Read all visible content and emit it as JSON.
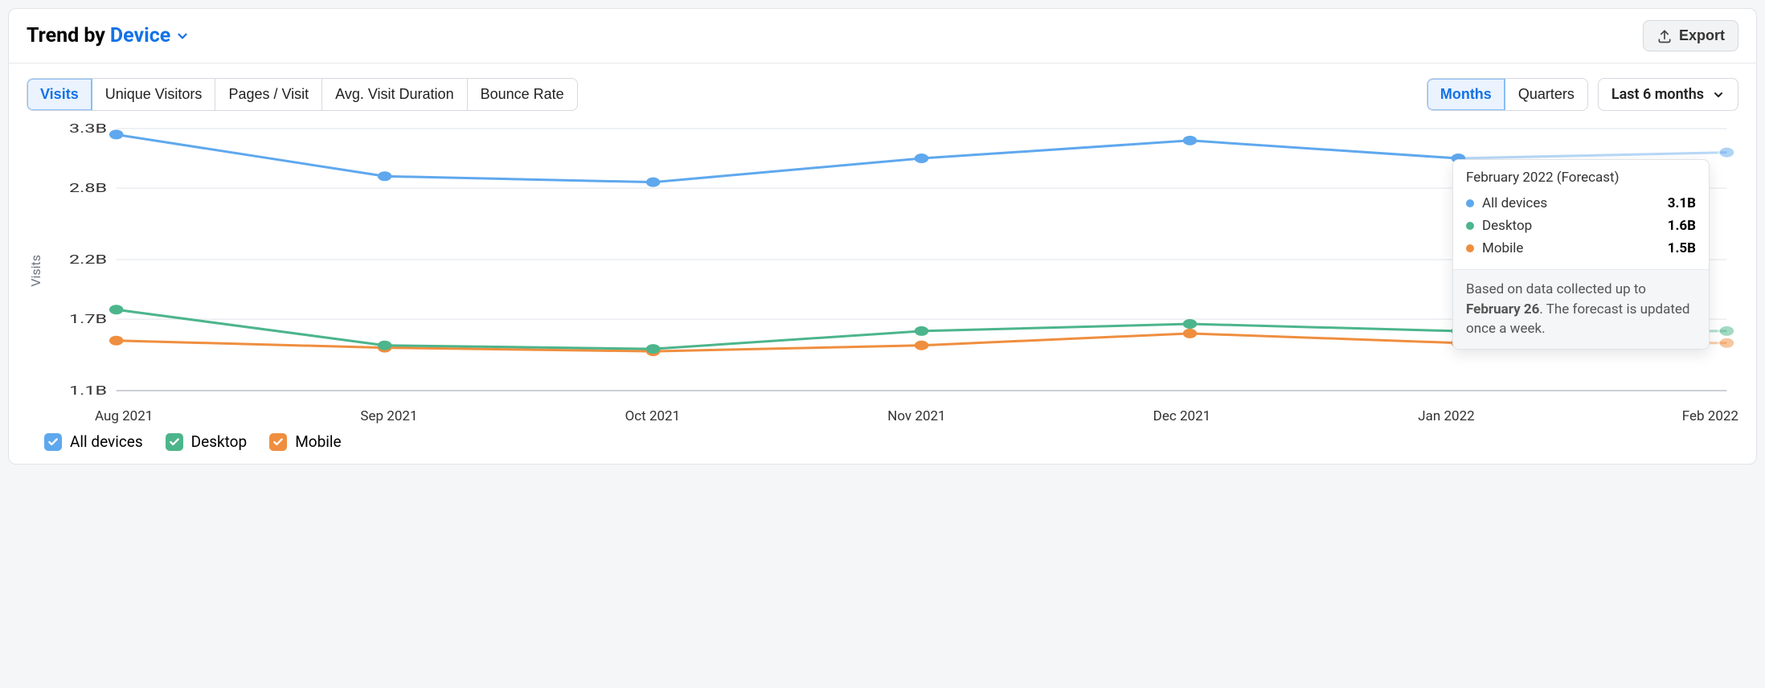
{
  "header": {
    "title_prefix": "Trend by",
    "title_link": "Device",
    "export_label": "Export"
  },
  "metrics": [
    "Visits",
    "Unique Visitors",
    "Pages / Visit",
    "Avg. Visit Duration",
    "Bounce Rate"
  ],
  "metric_selected": 0,
  "granularity": [
    "Months",
    "Quarters"
  ],
  "granularity_selected": 0,
  "range_label": "Last 6 months",
  "yaxis_title": "Visits",
  "yaxis_ticks": [
    "3.3B",
    "2.8B",
    "2.2B",
    "1.7B",
    "1.1B"
  ],
  "xaxis_ticks": [
    "Aug 2021",
    "Sep 2021",
    "Oct 2021",
    "Nov 2021",
    "Dec 2021",
    "Jan 2022",
    "Feb 2022"
  ],
  "legend": [
    {
      "label": "All devices",
      "color": "#5fa8ee"
    },
    {
      "label": "Desktop",
      "color": "#4cb58b"
    },
    {
      "label": "Mobile",
      "color": "#ef8e3f"
    }
  ],
  "tooltip": {
    "title": "February 2022 (Forecast)",
    "rows": [
      {
        "label": "All devices",
        "value": "3.1B",
        "color": "#5fa8ee"
      },
      {
        "label": "Desktop",
        "value": "1.6B",
        "color": "#4cb58b"
      },
      {
        "label": "Mobile",
        "value": "1.5B",
        "color": "#ef8e3f"
      }
    ],
    "footer_prefix": "Based on data collected up to ",
    "footer_bold": "February 26",
    "footer_suffix": ". The forecast is updated once a week."
  },
  "chart_data": {
    "type": "line",
    "title": "Trend by Device — Visits",
    "xlabel": "",
    "ylabel": "Visits",
    "ylim": [
      1.1,
      3.3
    ],
    "categories": [
      "Aug 2021",
      "Sep 2021",
      "Oct 2021",
      "Nov 2021",
      "Dec 2021",
      "Jan 2022",
      "Feb 2022"
    ],
    "series": [
      {
        "name": "All devices",
        "color": "#5fa8ee",
        "values": [
          3.25,
          2.9,
          2.85,
          3.05,
          3.2,
          3.05,
          3.1
        ],
        "forecast_from_index": 6
      },
      {
        "name": "Desktop",
        "color": "#4cb58b",
        "values": [
          1.78,
          1.48,
          1.45,
          1.6,
          1.66,
          1.6,
          1.6
        ],
        "forecast_from_index": 6
      },
      {
        "name": "Mobile",
        "color": "#ef8e3f",
        "values": [
          1.52,
          1.46,
          1.43,
          1.48,
          1.58,
          1.5,
          1.5
        ],
        "forecast_from_index": 6
      }
    ],
    "note": "values in billions (B); last point is a forecast"
  }
}
